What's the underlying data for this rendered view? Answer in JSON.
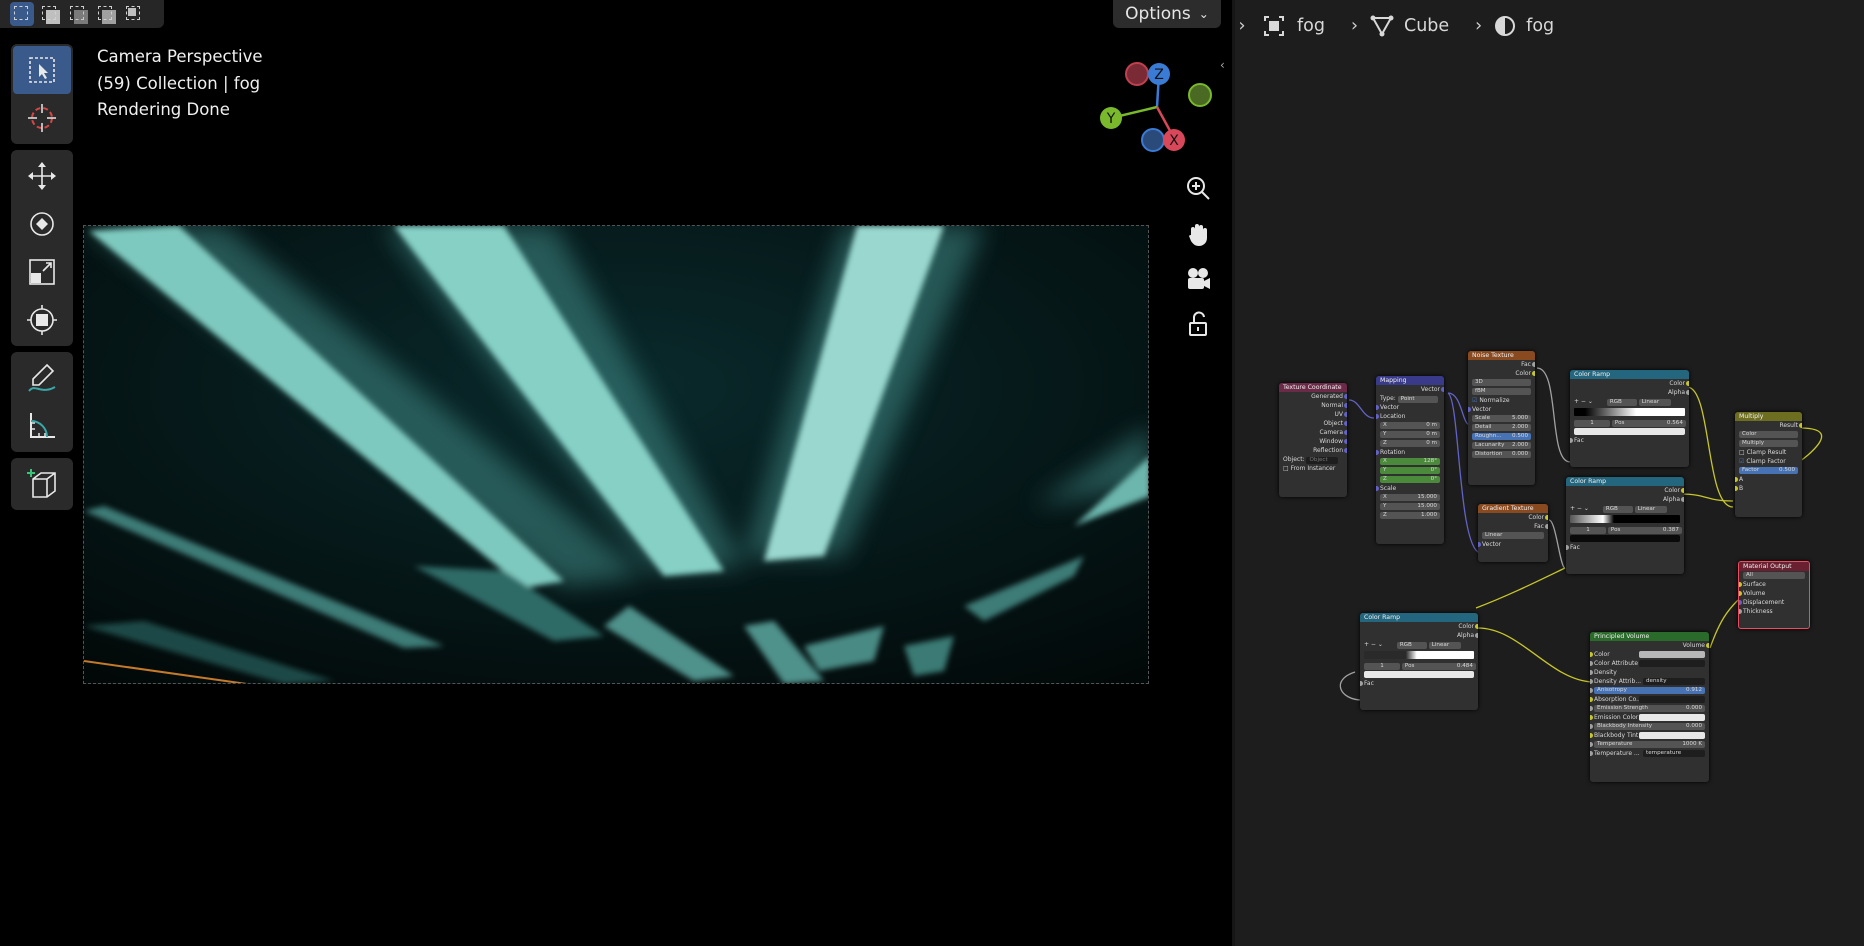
{
  "viewport": {
    "options_label": "Options",
    "info_lines": [
      "Camera Perspective",
      "(59) Collection | fog",
      "Rendering Done"
    ],
    "gizmo": {
      "z": "Z",
      "y": "Y",
      "x": "X"
    },
    "tools": [
      "select-box",
      "cursor",
      "move",
      "rotate",
      "scale",
      "transform",
      "annotate",
      "measure",
      "add-cube"
    ]
  },
  "breadcrumb": {
    "material_slot": "fog",
    "object": "Cube",
    "material": "fog"
  },
  "nodes": {
    "texcoord": {
      "title": "Texture Coordinate",
      "outputs": [
        "Generated",
        "Normal",
        "UV",
        "Object",
        "Camera",
        "Window",
        "Reflection"
      ],
      "object_label": "Object:",
      "object_placeholder": "Object",
      "from_instancer": "From Instancer"
    },
    "mapping": {
      "title": "Mapping",
      "out": "Vector",
      "type_label": "Type:",
      "type_value": "Point",
      "vector": "Vector",
      "location": "Location",
      "loc": [
        [
          "X",
          "0 m"
        ],
        [
          "Y",
          "0 m"
        ],
        [
          "Z",
          "0 m"
        ]
      ],
      "rotation": "Rotation",
      "rot": [
        [
          "X",
          "128°"
        ],
        [
          "Y",
          "0°"
        ],
        [
          "Z",
          "0°"
        ]
      ],
      "scale": "Scale",
      "scl": [
        [
          "X",
          "15.000"
        ],
        [
          "Y",
          "15.000"
        ],
        [
          "Z",
          "1.000"
        ]
      ]
    },
    "noise": {
      "title": "Noise Texture",
      "outputs": [
        "Fac",
        "Color"
      ],
      "dim": "3D",
      "type": "fBM",
      "normalize": "Normalize",
      "vector": "Vector",
      "fields": [
        [
          "Scale",
          "5.000"
        ],
        [
          "Detail",
          "2.000"
        ],
        [
          "Roughn...",
          "0.500"
        ],
        [
          "Lacunarity",
          "2.000"
        ],
        [
          "Distortion",
          "0.000"
        ]
      ]
    },
    "ramp1": {
      "title": "Color Ramp",
      "outputs": [
        "Color",
        "Alpha"
      ],
      "mode": "RGB",
      "interp": "Linear",
      "index": "1",
      "pos_label": "Pos",
      "pos": "0.564",
      "fac": "Fac"
    },
    "ramp2": {
      "title": "Color Ramp",
      "outputs": [
        "Color",
        "Alpha"
      ],
      "mode": "RGB",
      "interp": "Linear",
      "index": "1",
      "pos_label": "Pos",
      "pos": "0.387",
      "fac": "Fac"
    },
    "ramp3": {
      "title": "Color Ramp",
      "outputs": [
        "Color",
        "Alpha"
      ],
      "mode": "RGB",
      "interp": "Linear",
      "index": "1",
      "pos_label": "Pos",
      "pos": "0.484",
      "fac": "Fac"
    },
    "gradient": {
      "title": "Gradient Texture",
      "outputs": [
        "Color",
        "Fac"
      ],
      "type": "Linear",
      "vector": "Vector"
    },
    "multiply": {
      "title": "Multiply",
      "out": "Result",
      "type": "Color",
      "op": "Multiply",
      "clamp_result": "Clamp Result",
      "clamp_factor": "Clamp Factor",
      "factor_label": "Factor",
      "factor": "0.500",
      "a": "A",
      "b": "B"
    },
    "principled": {
      "title": "Principled Volume",
      "out": "Volume",
      "rows": [
        [
          "Color",
          ""
        ],
        [
          "Color Attribute",
          ""
        ],
        [
          "Density",
          ""
        ],
        [
          "Density Attrib...",
          "density"
        ],
        [
          "Anisotropy",
          "0.912"
        ],
        [
          "Absorption Co...",
          ""
        ],
        [
          "Emission Strength",
          "0.000"
        ],
        [
          "Emission Color",
          ""
        ],
        [
          "Blackbody Intensity",
          "0.000"
        ],
        [
          "Blackbody Tint",
          ""
        ],
        [
          "Temperature",
          "1000 K"
        ],
        [
          "Temperature ...",
          "temperature"
        ]
      ]
    },
    "output": {
      "title": "Material Output",
      "target": "All",
      "inputs": [
        "Surface",
        "Volume",
        "Displacement",
        "Thickness"
      ]
    }
  },
  "colors": {
    "accent": "#3b5a8c",
    "beam": "#7ec9bf",
    "selection": "#4772b3"
  }
}
